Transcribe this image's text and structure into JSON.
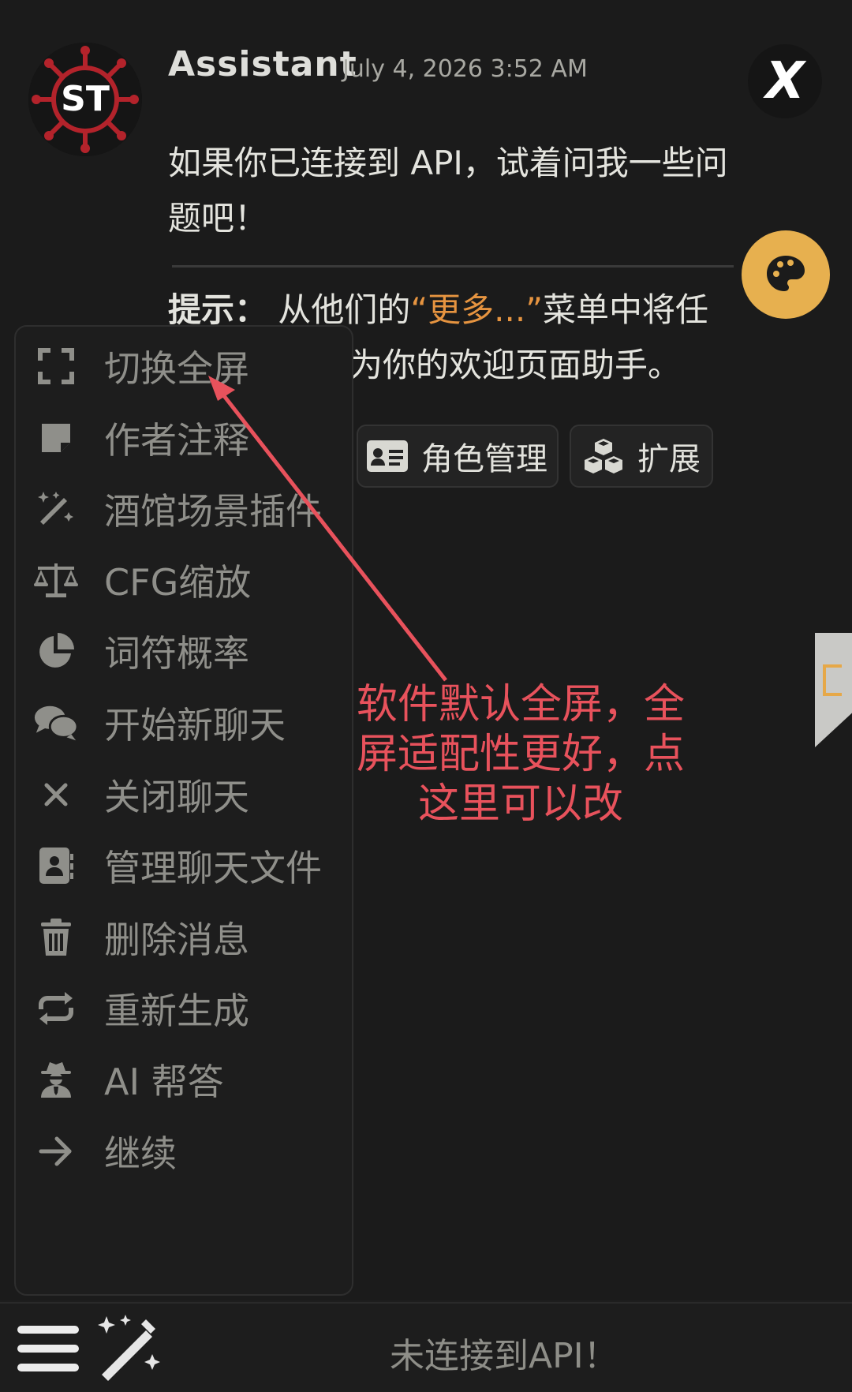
{
  "message": {
    "author": "Assistant",
    "timestamp": "July 4, 2026 3:52 AM",
    "avatar_text": "ST",
    "badge_text": "X",
    "text": "如果你已连接到 API，试着问我一些问题吧！",
    "hint_prefix": "提示：",
    "hint_part1": "从他们的",
    "hint_highlight": "“更多...”",
    "hint_part2": "菜单中将任",
    "hint_part3": "为你的欢迎页面助手。"
  },
  "action_buttons": [
    {
      "label": "角色管理",
      "icon": "id-card-icon"
    },
    {
      "label": "扩展",
      "icon": "cubes-icon"
    }
  ],
  "menu": {
    "items": [
      {
        "label": "切换全屏",
        "icon": "expand-icon"
      },
      {
        "label": "作者注释",
        "icon": "note-icon"
      },
      {
        "label": "酒馆场景插件",
        "icon": "magic-wand-icon"
      },
      {
        "label": "CFG缩放",
        "icon": "scale-icon"
      },
      {
        "label": "词符概率",
        "icon": "pie-chart-icon"
      },
      {
        "label": "开始新聊天",
        "icon": "comments-icon"
      },
      {
        "label": "关闭聊天",
        "icon": "close-icon"
      },
      {
        "label": "管理聊天文件",
        "icon": "address-book-icon"
      },
      {
        "label": "删除消息",
        "icon": "trash-icon"
      },
      {
        "label": "重新生成",
        "icon": "repeat-icon"
      },
      {
        "label": "AI 帮答",
        "icon": "user-secret-icon"
      },
      {
        "label": "继续",
        "icon": "arrow-right-icon"
      }
    ]
  },
  "bottom_bar": {
    "status": "未连接到API！"
  },
  "annotation": {
    "line1": "软件默认全屏，全",
    "line2": "屏适配性更好，点",
    "line3": "这里可以改"
  },
  "colors": {
    "accent_orange": "#e69440",
    "palette_button": "#e7b04f",
    "annotation_red": "#e8525c",
    "background": "#1b1b1b"
  }
}
